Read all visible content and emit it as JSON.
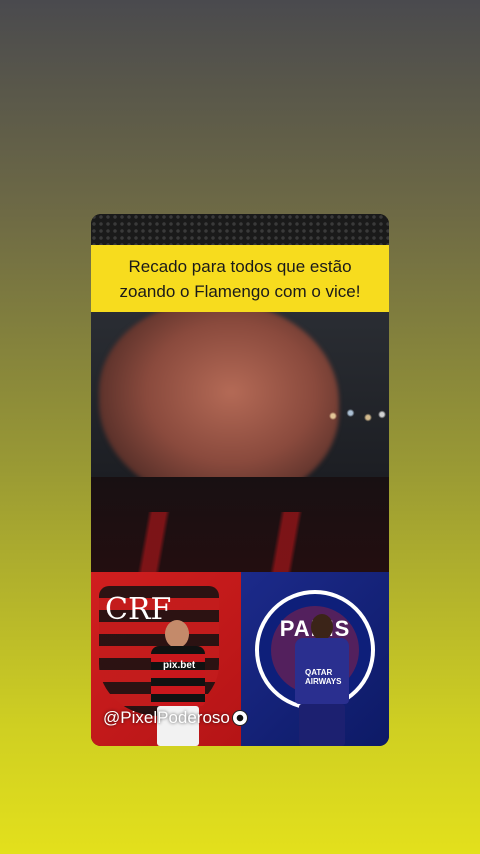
{
  "post": {
    "caption": "Recado para todos que estão zoando o Flamengo com o vice!",
    "watermark": "@PixelPoderoso",
    "left_crest_sponsor": "pix.bet",
    "left_crest_monogram": "CRF",
    "right_crest_word": "PARIS",
    "right_jersey_sponsor": "QATAR AIRWAYS"
  },
  "colors": {
    "caption_bg": "#f7dc1e",
    "flamengo_red": "#c8171c",
    "psg_blue": "#1c2a8a"
  }
}
